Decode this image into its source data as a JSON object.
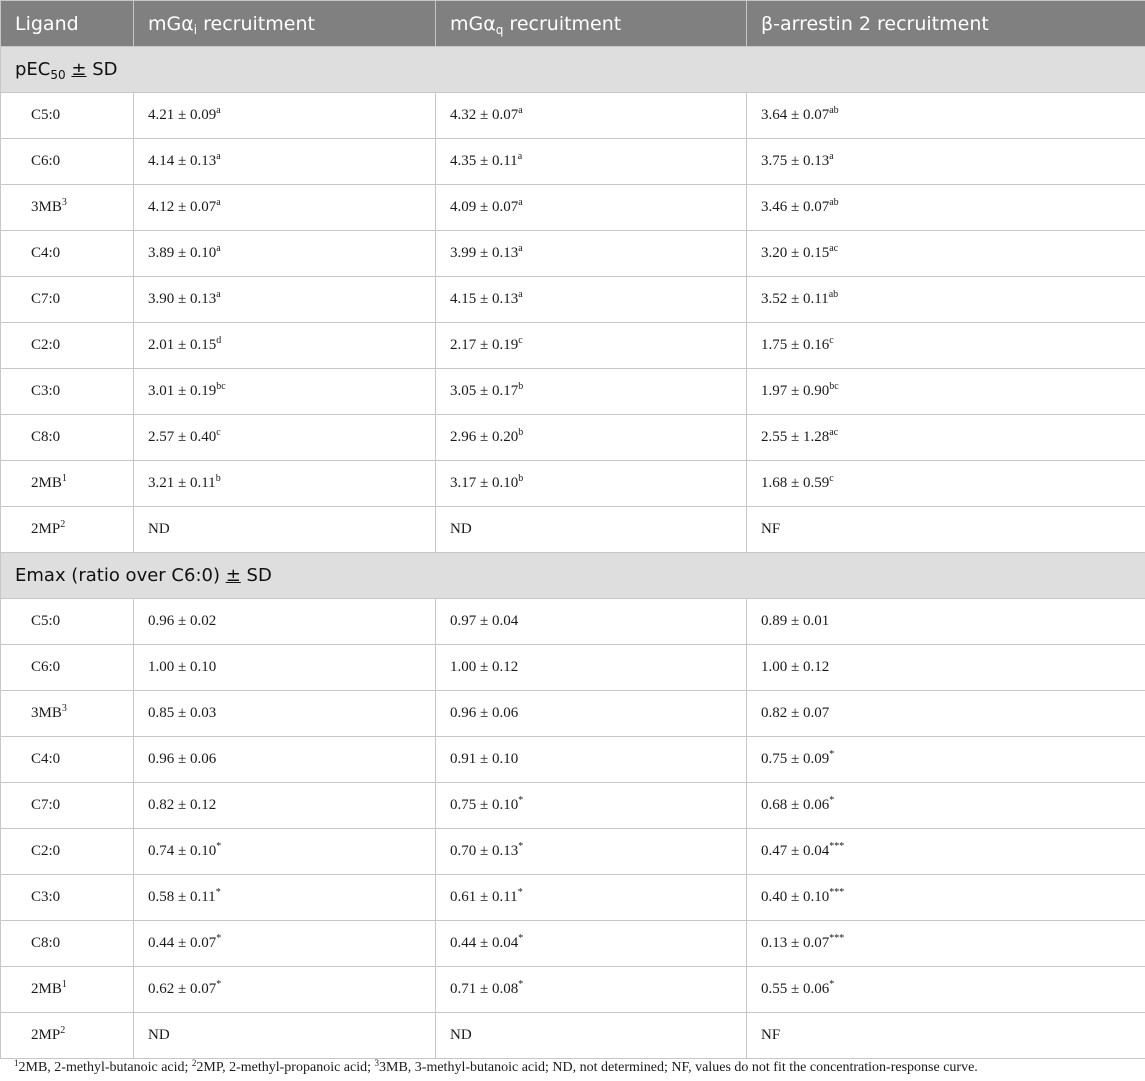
{
  "header": {
    "col1": "Ligand",
    "col2_pre": "mGα",
    "col2_sub": "i",
    "col2_post": " recruitment",
    "col3_pre": "mGα",
    "col3_sub": "q",
    "col3_post": " recruitment",
    "col4": "β-arrestin 2 recruitment"
  },
  "section1": {
    "pre": "pEC",
    "sub": "50",
    "pm": "±",
    "post": " SD"
  },
  "section1_rows": [
    {
      "ligand": "C5:0",
      "lsup": "",
      "gi": "4.21 ± 0.09",
      "gi_sup": "a",
      "gq": "4.32 ± 0.07",
      "gq_sup": "a",
      "ba": "3.64 ± 0.07",
      "ba_sup": "ab"
    },
    {
      "ligand": "C6:0",
      "lsup": "",
      "gi": "4.14 ± 0.13",
      "gi_sup": "a",
      "gq": "4.35 ± 0.11",
      "gq_sup": "a",
      "ba": "3.75 ± 0.13",
      "ba_sup": "a"
    },
    {
      "ligand": "3MB",
      "lsup": "3",
      "gi": "4.12 ± 0.07",
      "gi_sup": "a",
      "gq": "4.09 ± 0.07",
      "gq_sup": "a",
      "ba": "3.46 ± 0.07",
      "ba_sup": "ab"
    },
    {
      "ligand": "C4:0",
      "lsup": "",
      "gi": "3.89 ± 0.10",
      "gi_sup": "a",
      "gq": "3.99 ± 0.13",
      "gq_sup": "a",
      "ba": "3.20 ± 0.15",
      "ba_sup": "ac"
    },
    {
      "ligand": "C7:0",
      "lsup": "",
      "gi": "3.90 ± 0.13",
      "gi_sup": "a",
      "gq": "4.15 ± 0.13",
      "gq_sup": "a",
      "ba": "3.52 ± 0.11",
      "ba_sup": "ab"
    },
    {
      "ligand": "C2:0",
      "lsup": "",
      "gi": "2.01 ± 0.15",
      "gi_sup": "d",
      "gq": "2.17 ± 0.19",
      "gq_sup": "c",
      "ba": "1.75 ± 0.16",
      "ba_sup": "c"
    },
    {
      "ligand": "C3:0",
      "lsup": "",
      "gi": "3.01 ± 0.19",
      "gi_sup": "bc",
      "gq": "3.05 ± 0.17",
      "gq_sup": "b",
      "ba": "1.97 ± 0.90",
      "ba_sup": "bc"
    },
    {
      "ligand": "C8:0",
      "lsup": "",
      "gi": "2.57 ± 0.40",
      "gi_sup": "c",
      "gq": "2.96 ± 0.20",
      "gq_sup": "b",
      "ba": "2.55 ± 1.28",
      "ba_sup": "ac"
    },
    {
      "ligand": "2MB",
      "lsup": "1",
      "gi": "3.21 ± 0.11",
      "gi_sup": "b",
      "gq": "3.17 ± 0.10",
      "gq_sup": "b",
      "ba": "1.68 ± 0.59",
      "ba_sup": "c"
    },
    {
      "ligand": "2MP",
      "lsup": "2",
      "gi": "ND",
      "gi_sup": "",
      "gq": "ND",
      "gq_sup": "",
      "ba": "NF",
      "ba_sup": ""
    }
  ],
  "section2": {
    "pre": "Emax (ratio over C6:0) ",
    "pm": "±",
    "post": " SD"
  },
  "section2_rows": [
    {
      "ligand": "C5:0",
      "lsup": "",
      "gi": "0.96 ± 0.02",
      "gi_sup": "",
      "gq": "0.97 ± 0.04",
      "gq_sup": "",
      "ba": "0.89 ± 0.01",
      "ba_sup": ""
    },
    {
      "ligand": "C6:0",
      "lsup": "",
      "gi": "1.00 ± 0.10",
      "gi_sup": "",
      "gq": "1.00 ± 0.12",
      "gq_sup": "",
      "ba": "1.00 ± 0.12",
      "ba_sup": ""
    },
    {
      "ligand": "3MB",
      "lsup": "3",
      "gi": "0.85 ± 0.03",
      "gi_sup": "",
      "gq": "0.96 ± 0.06",
      "gq_sup": "",
      "ba": "0.82 ± 0.07",
      "ba_sup": ""
    },
    {
      "ligand": "C4:0",
      "lsup": "",
      "gi": "0.96 ± 0.06",
      "gi_sup": "",
      "gq": "0.91 ± 0.10",
      "gq_sup": "",
      "ba": "0.75 ± 0.09",
      "ba_sup": "*"
    },
    {
      "ligand": "C7:0",
      "lsup": "",
      "gi": "0.82 ± 0.12",
      "gi_sup": "",
      "gq": "0.75 ± 0.10",
      "gq_sup": "*",
      "ba": "0.68 ± 0.06",
      "ba_sup": "*"
    },
    {
      "ligand": "C2:0",
      "lsup": "",
      "gi": "0.74 ± 0.10",
      "gi_sup": "*",
      "gq": "0.70 ± 0.13",
      "gq_sup": "*",
      "ba": "0.47 ± 0.04",
      "ba_sup": "***"
    },
    {
      "ligand": "C3:0",
      "lsup": "",
      "gi": "0.58 ± 0.11",
      "gi_sup": "*",
      "gq": "0.61 ± 0.11",
      "gq_sup": "*",
      "ba": "0.40 ± 0.10",
      "ba_sup": "***"
    },
    {
      "ligand": "C8:0",
      "lsup": "",
      "gi": "0.44 ± 0.07",
      "gi_sup": "*",
      "gq": "0.44 ± 0.04",
      "gq_sup": "*",
      "ba": "0.13 ± 0.07",
      "ba_sup": "***"
    },
    {
      "ligand": "2MB",
      "lsup": "1",
      "gi": "0.62 ± 0.07",
      "gi_sup": "*",
      "gq": "0.71 ± 0.08",
      "gq_sup": "*",
      "ba": "0.55 ± 0.06",
      "ba_sup": "*"
    },
    {
      "ligand": "2MP",
      "lsup": "2",
      "gi": "ND",
      "gi_sup": "",
      "gq": "ND",
      "gq_sup": "",
      "ba": "NF",
      "ba_sup": ""
    }
  ],
  "footnote": [
    {
      "sup": "1",
      "text": "2MB, 2-methyl-butanoic acid; "
    },
    {
      "sup": "2",
      "text": "2MP, 2-methyl-propanoic acid; "
    },
    {
      "sup": "3",
      "text": "3MB, 3-methyl-butanoic acid; ND, not determined; NF, values do not fit the concentration-response curve."
    }
  ]
}
